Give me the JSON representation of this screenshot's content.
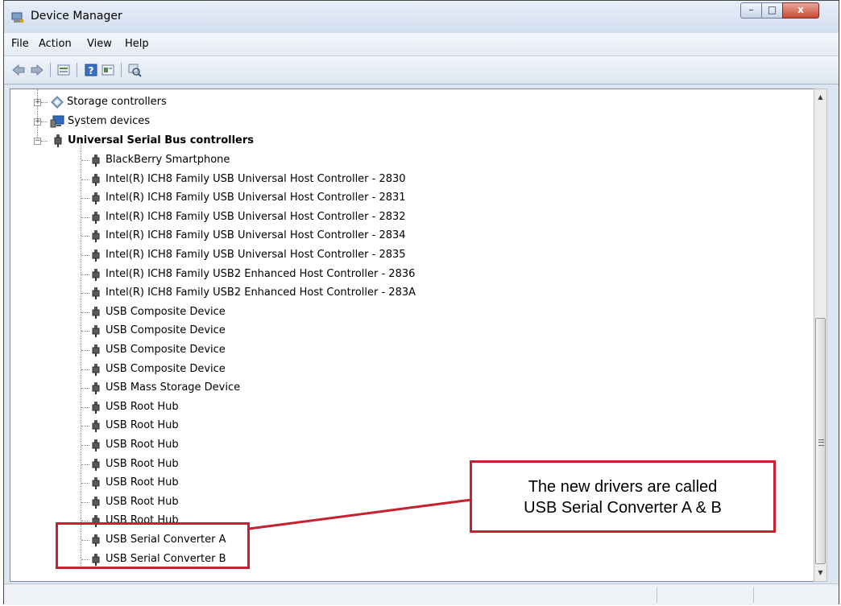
{
  "window": {
    "title": "Device Manager",
    "controls": {
      "minimize": "–",
      "maximize": "□",
      "close": "x"
    }
  },
  "menubar": {
    "items": [
      "File",
      "Action",
      "View",
      "Help"
    ]
  },
  "toolbar": {
    "icons": [
      "back-arrow-icon",
      "forward-arrow-icon",
      "properties-icon",
      "help-icon",
      "view-icon",
      "scan-hardware-icon"
    ]
  },
  "tree": {
    "categories": [
      {
        "label": "Storage controllers",
        "expanded": false,
        "icon": "storage-controller-icon"
      },
      {
        "label": "System devices",
        "expanded": false,
        "icon": "system-devices-icon"
      },
      {
        "label": "Universal Serial Bus controllers",
        "expanded": true,
        "icon": "usb-plug-icon"
      }
    ],
    "usb_children": [
      "BlackBerry Smartphone",
      "Intel(R) ICH8 Family USB Universal Host Controller - 2830",
      "Intel(R) ICH8 Family USB Universal Host Controller - 2831",
      "Intel(R) ICH8 Family USB Universal Host Controller - 2832",
      "Intel(R) ICH8 Family USB Universal Host Controller - 2834",
      "Intel(R) ICH8 Family USB Universal Host Controller - 2835",
      "Intel(R) ICH8 Family USB2 Enhanced Host Controller - 2836",
      "Intel(R) ICH8 Family USB2 Enhanced Host Controller - 283A",
      "USB Composite Device",
      "USB Composite Device",
      "USB Composite Device",
      "USB Composite Device",
      "USB Mass Storage Device",
      "USB Root Hub",
      "USB Root Hub",
      "USB Root Hub",
      "USB Root Hub",
      "USB Root Hub",
      "USB Root Hub",
      "USB Root Hub",
      "USB Serial Converter A",
      "USB Serial Converter B"
    ]
  },
  "callout": {
    "line1": "The new drivers are called",
    "line2": "USB Serial Converter A & B"
  },
  "colors": {
    "callout": "#c8202f"
  }
}
